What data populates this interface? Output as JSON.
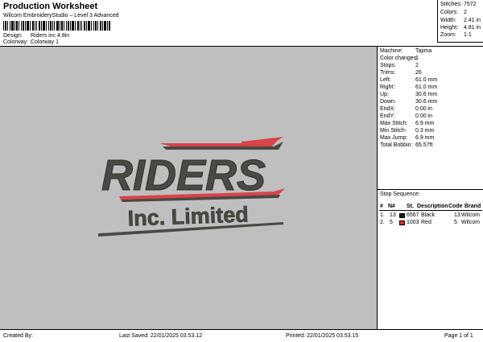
{
  "header": {
    "title": "Production Worksheet",
    "subtitle": "Wilcom EmbroideryStudio – Level 3 Advanced",
    "design_label": "Design:",
    "design_value": "Riders inc 4.8in",
    "colorway_label": "Colorway:",
    "colorway_value": "Colorway 1"
  },
  "stats": {
    "stitches_label": "Stitches:",
    "stitches_value": "7572",
    "colors_label": "Colors:",
    "colors_value": "2",
    "width_label": "Width:",
    "width_value": "2.41 in",
    "height_label": "Height:",
    "height_value": "4.81 in",
    "zoom_label": "Zoom:",
    "zoom_value": "1:1"
  },
  "design": {
    "word_main": "RIDERS",
    "word_sub": "Inc. Limited",
    "colors": {
      "dark": "#4a4a44",
      "red": "#d9434a",
      "background": "#bfbfbf"
    }
  },
  "properties": [
    {
      "label": "Machine:",
      "value": "Tajima"
    },
    {
      "label": "Color changes:",
      "value": "1"
    },
    {
      "label": "Stops:",
      "value": "2"
    },
    {
      "label": "Trims:",
      "value": "26"
    },
    {
      "label": "Left:",
      "value": "61.0 mm"
    },
    {
      "label": "Right:",
      "value": "61.0 mm"
    },
    {
      "label": "Up:",
      "value": "30.6 mm"
    },
    {
      "label": "Down:",
      "value": "30.6 mm"
    },
    {
      "label": "EndX:",
      "value": "0.00 in"
    },
    {
      "label": "EndY:",
      "value": "0.00 in"
    },
    {
      "label": "Max Stitch:",
      "value": "6.9 mm"
    },
    {
      "label": "Min Stitch:",
      "value": "0.3 mm"
    },
    {
      "label": "Max Jump:",
      "value": "6.9 mm"
    },
    {
      "label": "Total Bobbin:",
      "value": "65.57ft"
    }
  ],
  "sequence": {
    "title": "Stop Sequence:",
    "headers": {
      "num": "#",
      "n": "N#",
      "st": "St.",
      "desc": "Description",
      "code": "Code",
      "brand": "Brand"
    },
    "rows": [
      {
        "num": "1.",
        "n": "13",
        "st": "6567",
        "desc": "Black",
        "code": "13",
        "brand": "Wilcom",
        "color": "#1a1a1a"
      },
      {
        "num": "2.",
        "n": "5",
        "st": "1003",
        "desc": "Red",
        "code": "5",
        "brand": "Wilcom",
        "color": "#e0282c"
      }
    ]
  },
  "footer": {
    "created_by": "Created By:",
    "last_saved": "Last Saved: 22/01/2025 03.53.12",
    "printed": "Printed: 22/01/2025 03.53.15",
    "page": "Page 1 of 1"
  }
}
